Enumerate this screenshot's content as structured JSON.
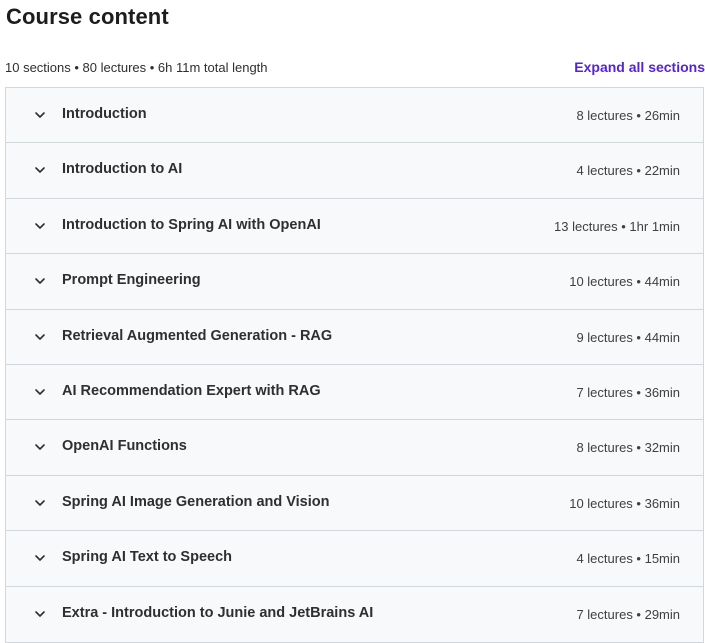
{
  "header": {
    "title": "Course content",
    "summary": "10 sections • 80 lectures • 6h 11m total length",
    "expand_label": "Expand all sections"
  },
  "icons": {
    "section_toggle": "chevron-down-icon"
  },
  "colors": {
    "accent": "#5624d0",
    "row_bg": "#f7f9fa",
    "border": "#d1d7dc"
  },
  "sections": [
    {
      "title": "Introduction",
      "info": "8 lectures • 26min"
    },
    {
      "title": "Introduction to AI",
      "info": "4 lectures • 22min"
    },
    {
      "title": "Introduction to Spring AI with OpenAI",
      "info": "13 lectures • 1hr 1min"
    },
    {
      "title": "Prompt Engineering",
      "info": "10 lectures • 44min"
    },
    {
      "title": "Retrieval Augmented Generation - RAG",
      "info": "9 lectures • 44min"
    },
    {
      "title": "AI Recommendation Expert with RAG",
      "info": "7 lectures • 36min"
    },
    {
      "title": "OpenAI Functions",
      "info": "8 lectures • 32min"
    },
    {
      "title": "Spring AI Image Generation and Vision",
      "info": "10 lectures • 36min"
    },
    {
      "title": "Spring AI Text to Speech",
      "info": "4 lectures • 15min"
    },
    {
      "title": "Extra - Introduction to Junie and JetBrains AI",
      "info": "7 lectures • 29min"
    }
  ]
}
